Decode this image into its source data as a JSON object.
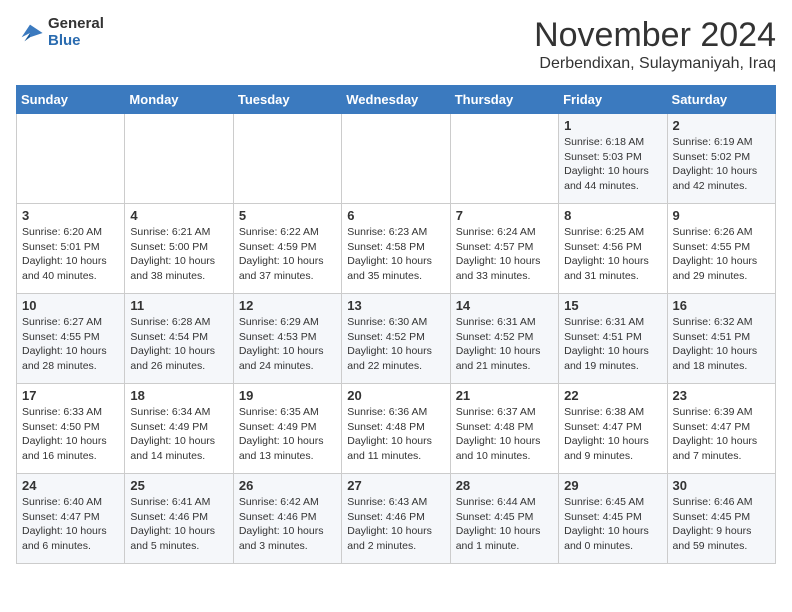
{
  "header": {
    "logo_general": "General",
    "logo_blue": "Blue",
    "month_title": "November 2024",
    "location": "Derbendixan, Sulaymaniyah, Iraq"
  },
  "days_of_week": [
    "Sunday",
    "Monday",
    "Tuesday",
    "Wednesday",
    "Thursday",
    "Friday",
    "Saturday"
  ],
  "weeks": [
    [
      {
        "day": "",
        "info": ""
      },
      {
        "day": "",
        "info": ""
      },
      {
        "day": "",
        "info": ""
      },
      {
        "day": "",
        "info": ""
      },
      {
        "day": "",
        "info": ""
      },
      {
        "day": "1",
        "info": "Sunrise: 6:18 AM\nSunset: 5:03 PM\nDaylight: 10 hours\nand 44 minutes."
      },
      {
        "day": "2",
        "info": "Sunrise: 6:19 AM\nSunset: 5:02 PM\nDaylight: 10 hours\nand 42 minutes."
      }
    ],
    [
      {
        "day": "3",
        "info": "Sunrise: 6:20 AM\nSunset: 5:01 PM\nDaylight: 10 hours\nand 40 minutes."
      },
      {
        "day": "4",
        "info": "Sunrise: 6:21 AM\nSunset: 5:00 PM\nDaylight: 10 hours\nand 38 minutes."
      },
      {
        "day": "5",
        "info": "Sunrise: 6:22 AM\nSunset: 4:59 PM\nDaylight: 10 hours\nand 37 minutes."
      },
      {
        "day": "6",
        "info": "Sunrise: 6:23 AM\nSunset: 4:58 PM\nDaylight: 10 hours\nand 35 minutes."
      },
      {
        "day": "7",
        "info": "Sunrise: 6:24 AM\nSunset: 4:57 PM\nDaylight: 10 hours\nand 33 minutes."
      },
      {
        "day": "8",
        "info": "Sunrise: 6:25 AM\nSunset: 4:56 PM\nDaylight: 10 hours\nand 31 minutes."
      },
      {
        "day": "9",
        "info": "Sunrise: 6:26 AM\nSunset: 4:55 PM\nDaylight: 10 hours\nand 29 minutes."
      }
    ],
    [
      {
        "day": "10",
        "info": "Sunrise: 6:27 AM\nSunset: 4:55 PM\nDaylight: 10 hours\nand 28 minutes."
      },
      {
        "day": "11",
        "info": "Sunrise: 6:28 AM\nSunset: 4:54 PM\nDaylight: 10 hours\nand 26 minutes."
      },
      {
        "day": "12",
        "info": "Sunrise: 6:29 AM\nSunset: 4:53 PM\nDaylight: 10 hours\nand 24 minutes."
      },
      {
        "day": "13",
        "info": "Sunrise: 6:30 AM\nSunset: 4:52 PM\nDaylight: 10 hours\nand 22 minutes."
      },
      {
        "day": "14",
        "info": "Sunrise: 6:31 AM\nSunset: 4:52 PM\nDaylight: 10 hours\nand 21 minutes."
      },
      {
        "day": "15",
        "info": "Sunrise: 6:31 AM\nSunset: 4:51 PM\nDaylight: 10 hours\nand 19 minutes."
      },
      {
        "day": "16",
        "info": "Sunrise: 6:32 AM\nSunset: 4:51 PM\nDaylight: 10 hours\nand 18 minutes."
      }
    ],
    [
      {
        "day": "17",
        "info": "Sunrise: 6:33 AM\nSunset: 4:50 PM\nDaylight: 10 hours\nand 16 minutes."
      },
      {
        "day": "18",
        "info": "Sunrise: 6:34 AM\nSunset: 4:49 PM\nDaylight: 10 hours\nand 14 minutes."
      },
      {
        "day": "19",
        "info": "Sunrise: 6:35 AM\nSunset: 4:49 PM\nDaylight: 10 hours\nand 13 minutes."
      },
      {
        "day": "20",
        "info": "Sunrise: 6:36 AM\nSunset: 4:48 PM\nDaylight: 10 hours\nand 11 minutes."
      },
      {
        "day": "21",
        "info": "Sunrise: 6:37 AM\nSunset: 4:48 PM\nDaylight: 10 hours\nand 10 minutes."
      },
      {
        "day": "22",
        "info": "Sunrise: 6:38 AM\nSunset: 4:47 PM\nDaylight: 10 hours\nand 9 minutes."
      },
      {
        "day": "23",
        "info": "Sunrise: 6:39 AM\nSunset: 4:47 PM\nDaylight: 10 hours\nand 7 minutes."
      }
    ],
    [
      {
        "day": "24",
        "info": "Sunrise: 6:40 AM\nSunset: 4:47 PM\nDaylight: 10 hours\nand 6 minutes."
      },
      {
        "day": "25",
        "info": "Sunrise: 6:41 AM\nSunset: 4:46 PM\nDaylight: 10 hours\nand 5 minutes."
      },
      {
        "day": "26",
        "info": "Sunrise: 6:42 AM\nSunset: 4:46 PM\nDaylight: 10 hours\nand 3 minutes."
      },
      {
        "day": "27",
        "info": "Sunrise: 6:43 AM\nSunset: 4:46 PM\nDaylight: 10 hours\nand 2 minutes."
      },
      {
        "day": "28",
        "info": "Sunrise: 6:44 AM\nSunset: 4:45 PM\nDaylight: 10 hours\nand 1 minute."
      },
      {
        "day": "29",
        "info": "Sunrise: 6:45 AM\nSunset: 4:45 PM\nDaylight: 10 hours\nand 0 minutes."
      },
      {
        "day": "30",
        "info": "Sunrise: 6:46 AM\nSunset: 4:45 PM\nDaylight: 9 hours\nand 59 minutes."
      }
    ]
  ]
}
